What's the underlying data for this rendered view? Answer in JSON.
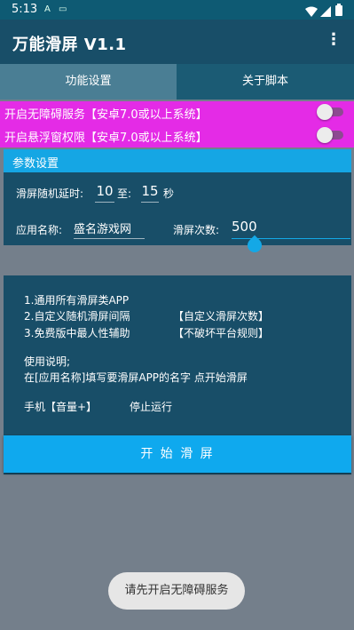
{
  "status_bar": {
    "time": "5:13"
  },
  "app_bar": {
    "title": "万能滑屏 V1.1",
    "menu_icon": "more-vertical-icon"
  },
  "tabs": [
    {
      "label": "功能设置",
      "selected": true
    },
    {
      "label": "关于脚本",
      "selected": false
    }
  ],
  "switches": [
    {
      "label": "开启无障碍服务【安卓7.0或以上系统】",
      "checked": false
    },
    {
      "label": "开启悬浮窗权限【安卓7.0或以上系统】",
      "checked": false
    }
  ],
  "params": {
    "header": "参数设置",
    "delay_label": "滑屏随机延时:",
    "delay_min": "10",
    "to_label": "至:",
    "delay_max": "15",
    "seconds_label": "秒",
    "app_name_label": "应用名称:",
    "app_name_value": "盛名游戏网",
    "swipe_count_label": "滑屏次数:",
    "swipe_count_value": "500"
  },
  "info": {
    "line1": "1.通用所有滑屏类APP",
    "line2_left": "2.自定义随机滑屏间隔",
    "line2_right": "【自定义滑屏次数】",
    "line3_left": "3.免费版中最人性辅助",
    "line3_right": "【不破坏平台规则】",
    "usage_title": "使用说明;",
    "usage_text": "在[应用名称]填写要滑屏APP的名字 点开始滑屏",
    "volume_label": "手机【音量+】",
    "stop_label": "停止运行"
  },
  "start_button": "开 始 滑 屏",
  "toast": "请先开启无障碍服务",
  "colors": {
    "primary": "#184e68",
    "accent": "#0fa9ee",
    "switch_row": "#e42be6"
  }
}
